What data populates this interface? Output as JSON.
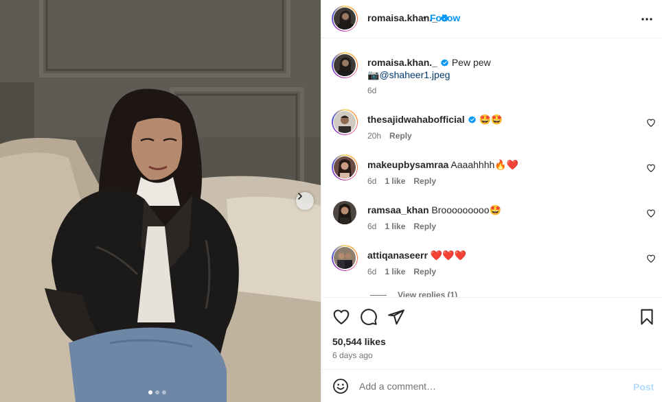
{
  "post": {
    "images_total": 3,
    "active_image": 1
  },
  "header": {
    "username": "romaisa.khan._",
    "separator": "•",
    "follow_label": "Follow"
  },
  "caption": {
    "username": "romaisa.khan._",
    "text": "Pew pew",
    "camera_emoji": "📷",
    "mention": "@shaheer1.jpeg",
    "time": "6d"
  },
  "comments": [
    {
      "username": "thesajidwahabofficial",
      "verified": true,
      "text": "🤩🤩",
      "time": "20h",
      "likes": "",
      "reply_label": "Reply"
    },
    {
      "username": "makeupbysamraa",
      "verified": false,
      "text": "Aaaahhhh🔥❤️",
      "time": "6d",
      "likes": "1 like",
      "reply_label": "Reply"
    },
    {
      "username": "ramsaa_khan",
      "verified": false,
      "text": "Brooooooooo🤩",
      "time": "6d",
      "likes": "1 like",
      "reply_label": "Reply"
    },
    {
      "username": "attiqanaseerr",
      "verified": false,
      "text": "❤️❤️❤️",
      "time": "6d",
      "likes": "1 like",
      "reply_label": "Reply"
    }
  ],
  "view_replies": "View replies (1)",
  "stats": {
    "likes": "50,544 likes",
    "posted": "6 days ago"
  },
  "composer": {
    "placeholder": "Add a comment…",
    "post_label": "Post"
  },
  "colors": {
    "accent": "#0095f6",
    "verified": "#0095f6",
    "muted": "#737373",
    "post_disabled": "#b3dbff"
  }
}
